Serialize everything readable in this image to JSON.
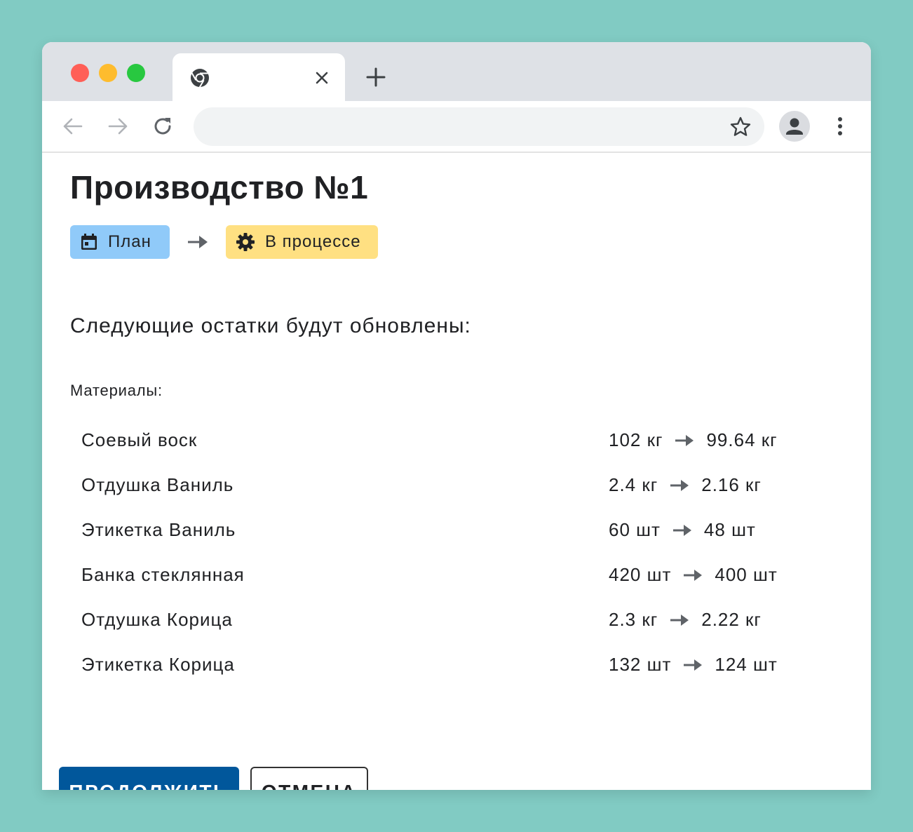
{
  "browser": {
    "tab": {
      "favicon": "chrome-icon",
      "close_icon": "close-icon"
    },
    "new_tab_icon": "plus-icon",
    "toolbar": {
      "back_icon": "arrow-left-icon",
      "forward_icon": "arrow-right-icon",
      "reload_icon": "reload-icon",
      "address_value": "",
      "bookmark_icon": "star-icon",
      "profile_icon": "person-icon",
      "menu_icon": "more-vert-icon"
    }
  },
  "page": {
    "title": "Производство №1",
    "status_flow": {
      "from": {
        "label": "План",
        "icon": "calendar-icon",
        "color": "#90caf9"
      },
      "arrow_icon": "arrow-right-icon",
      "to": {
        "label": "В процессе",
        "icon": "gear-icon",
        "color": "#ffe082"
      }
    },
    "subtitle": "Следующие остатки будут обновлены:",
    "materials_label": "Материалы:",
    "materials": [
      {
        "name": "Соевый воск",
        "from": "102 кг",
        "to": "99.64 кг"
      },
      {
        "name": "Отдушка Ваниль",
        "from": "2.4 кг",
        "to": "2.16 кг"
      },
      {
        "name": "Этикетка Ваниль",
        "from": "60 шт",
        "to": "48 шт"
      },
      {
        "name": "Банка стеклянная",
        "from": "420 шт",
        "to": "400 шт"
      },
      {
        "name": "Отдушка Корица",
        "from": "2.3 кг",
        "to": "2.22 кг"
      },
      {
        "name": "Этикетка Корица",
        "from": "132 шт",
        "to": "124 шт"
      }
    ],
    "actions": {
      "continue_label": "ПРОДОЛЖИТЬ",
      "cancel_label": "ОТМЕНА"
    }
  },
  "colors": {
    "background": "#81cbc3",
    "primary_button": "#01579b"
  }
}
